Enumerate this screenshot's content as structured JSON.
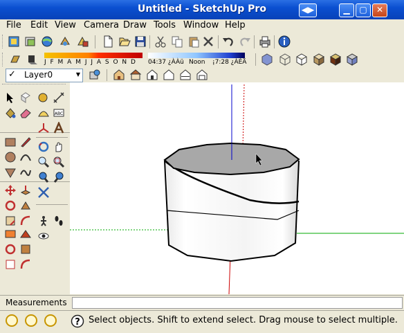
{
  "window": {
    "title": "Untitled - SketchUp Pro",
    "controls": [
      "minimize-icon",
      "maximize-icon",
      "close-icon"
    ]
  },
  "menu": [
    "File",
    "Edit",
    "View",
    "Camera",
    "Draw",
    "Tools",
    "Window",
    "Help"
  ],
  "shadow_toolbar": {
    "months": "J F M A M J J A S O N D",
    "time_start": "04:37 ¿ÀÀü",
    "time_noon": "Noon",
    "time_end": "¡7:28 ¿ÀÈÄ"
  },
  "layer": {
    "name": "Layer0"
  },
  "measurements": {
    "label": "Measurements",
    "value": ""
  },
  "status": {
    "text": "Select objects. Shift to extend select. Drag mouse to select multiple."
  },
  "colors": {
    "title_bar": "#0a4fd0",
    "axis_blue": "#0000cc",
    "axis_red": "#cc0000",
    "axis_green": "#00aa00",
    "cylinder_top": "#a8a8a8"
  }
}
